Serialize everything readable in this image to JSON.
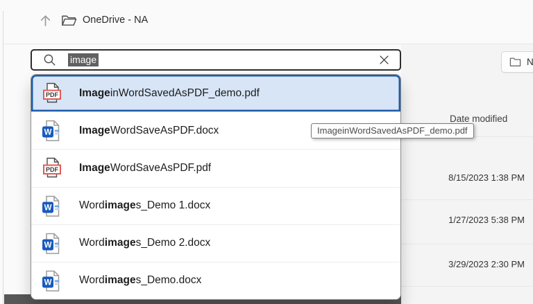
{
  "breadcrumb": {
    "location": "OneDrive - NA"
  },
  "search": {
    "value": "image"
  },
  "new_button": {
    "label_visible": "N"
  },
  "suggestions": {
    "items": [
      {
        "icon": "pdf",
        "pre": "",
        "match": "Image",
        "post": "inWordSavedAsPDF_demo.pdf",
        "selected": true
      },
      {
        "icon": "word",
        "pre": "",
        "match": "Image",
        "post": "WordSaveAsPDF.docx",
        "selected": false
      },
      {
        "icon": "pdf",
        "pre": "",
        "match": "Image",
        "post": "WordSaveAsPDF.pdf",
        "selected": false
      },
      {
        "icon": "word",
        "pre": "Word",
        "match": "image",
        "post": "s_Demo 1.docx",
        "selected": false
      },
      {
        "icon": "word",
        "pre": "Word",
        "match": "image",
        "post": "s_Demo 2.docx",
        "selected": false
      },
      {
        "icon": "word",
        "pre": "Word",
        "match": "image",
        "post": "s_Demo.docx",
        "selected": false
      }
    ]
  },
  "tooltip": {
    "text": "ImageinWordSavedAsPDF_demo.pdf"
  },
  "file_list": {
    "column_header": "Date modified",
    "dates": [
      "8/15/2023 1:38 PM",
      "1/27/2023 5:38 PM",
      "3/29/2023 2:30 PM"
    ]
  },
  "colors": {
    "accent_selection_border": "#1e5caa",
    "selected_row_bg": "#d7e5f6",
    "input_selection_bg": "#616161",
    "pdf_red": "#e15a55",
    "word_blue": "#185abd",
    "dark_strip": "#575757"
  }
}
